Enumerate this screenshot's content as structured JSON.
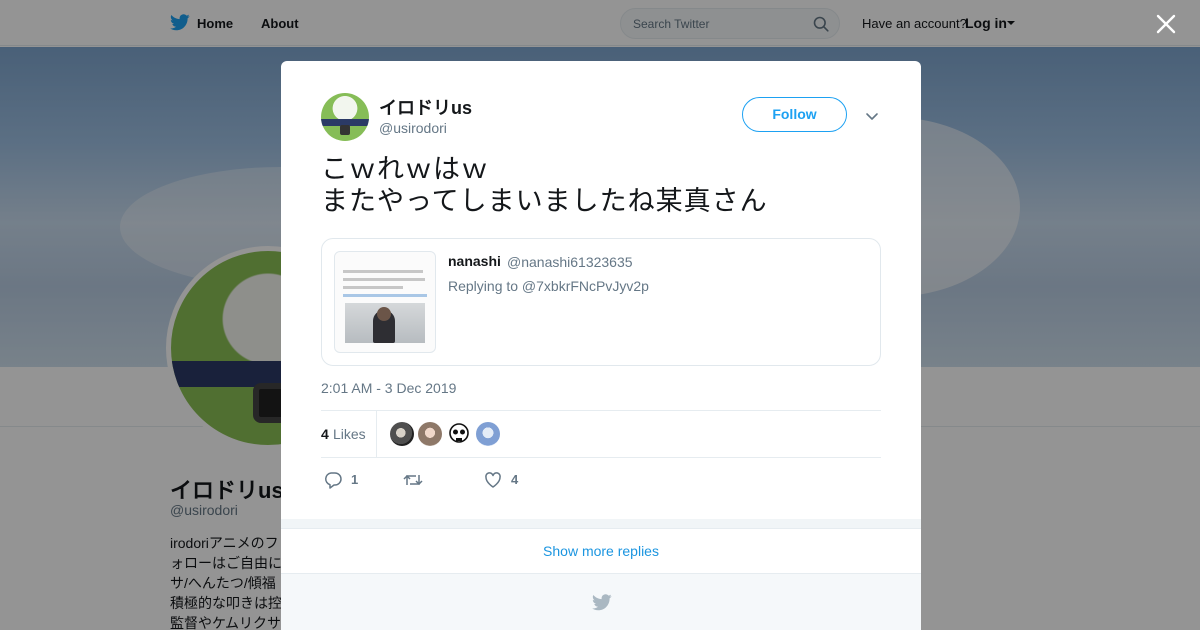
{
  "topbar": {
    "home_label": "Home",
    "about_label": "About",
    "search_placeholder": "Search Twitter",
    "have_account": "Have an account?",
    "login_label": "Log in"
  },
  "profile": {
    "name": "イロドリus",
    "handle": "@usirodori",
    "bio_lines": [
      "irodoriアニメのフ",
      "ォローはご自由に",
      "サ/へんたつ/傾福",
      "積極的な叩きは控",
      "監督やケムリクサ"
    ]
  },
  "tweet": {
    "author_name": "イロドリus",
    "author_handle": "@usirodori",
    "follow_label": "Follow",
    "text_lines": [
      "こｗれｗはｗ",
      "またやってしまいましたね某真さん"
    ],
    "quoted": {
      "name": "nanashi",
      "handle": "@nanashi61323635",
      "reply_to": "Replying to @7xbkrFNcPvJyv2p"
    },
    "timestamp": "2:01 AM - 3 Dec 2019",
    "likes_count": "4",
    "likes_label": "Likes",
    "reply_count": "1",
    "retweet_count": "",
    "like_count": "4"
  },
  "show_more_label": "Show more replies",
  "colors": {
    "brand": "#1da1f2",
    "link": "#1b95e0",
    "muted": "#657786",
    "text": "#14171a"
  },
  "icons": {
    "topbar_logo": "twitter-bird-icon",
    "search": "search-icon",
    "close": "close-icon",
    "caret": "chevron-down-icon",
    "reply": "reply-icon",
    "retweet": "retweet-icon",
    "like": "heart-icon",
    "footer_logo": "twitter-bird-icon"
  }
}
